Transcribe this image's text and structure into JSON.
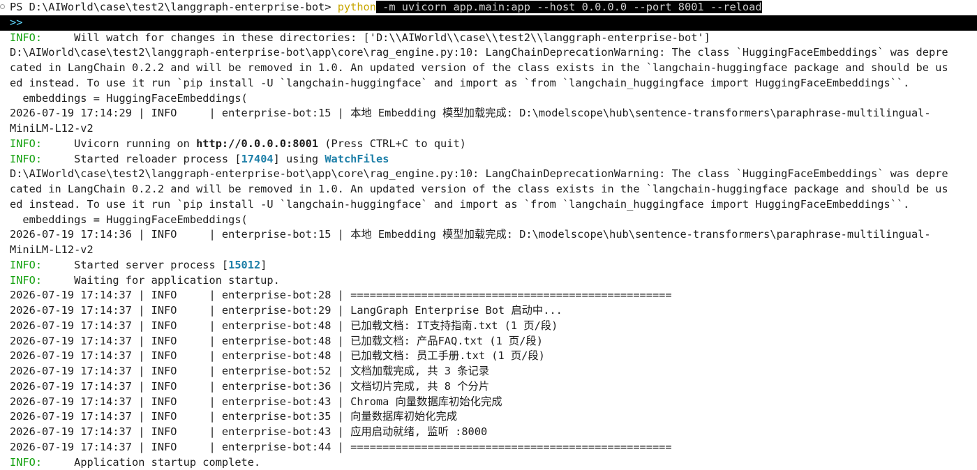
{
  "window": {
    "type": "PowerShell terminal"
  },
  "prompt": {
    "ps_prefix": "PS D:\\AIWorld\\case\\test2\\langgraph-enterprise-bot> ",
    "command": "python",
    "args": " -m uvicorn app.main:app --host 0.0.0.0 --port 8001 --reload",
    "continuation": ">>"
  },
  "output": {
    "l1_tag": "INFO:",
    "l1_text": "     Will watch for changes in these directories: ['D:\\\\AIWorld\\\\case\\\\test2\\\\langgraph-enterprise-bot']",
    "warn1_a": "D:\\AIWorld\\case\\test2\\langgraph-enterprise-bot\\app\\core\\rag_engine.py:10: LangChainDeprecationWarning: The class `HuggingFaceEmbeddings` was depre",
    "warn1_b": "cated in LangChain 0.2.2 and will be removed in 1.0. An updated version of the class exists in the `langchain-huggingface package and should be us",
    "warn1_c": "ed instead. To use it run `pip install -U `langchain-huggingface` and import as `from `langchain_huggingface import HuggingFaceEmbeddings``.",
    "warn1_d": "  embeddings = HuggingFaceEmbeddings(",
    "log1_a": "2026-07-19 17:14:29 | INFO     | enterprise-bot:15 | 本地 Embedding 模型加载完成: D:\\modelscope\\hub\\sentence-transformers\\paraphrase-multilingual-",
    "log1_b": "MiniLM-L12-v2",
    "l2_tag": "INFO:",
    "l2_pre": "     Uvicorn running on ",
    "l2_url": "http://0.0.0.0:8001",
    "l2_post": " (Press CTRL+C to quit)",
    "l3_tag": "INFO:",
    "l3_pre": "     Started reloader process [",
    "l3_pid": "17404",
    "l3_mid": "] using ",
    "l3_watch": "WatchFiles",
    "warn2_a": "D:\\AIWorld\\case\\test2\\langgraph-enterprise-bot\\app\\core\\rag_engine.py:10: LangChainDeprecationWarning: The class `HuggingFaceEmbeddings` was depre",
    "warn2_b": "cated in LangChain 0.2.2 and will be removed in 1.0. An updated version of the class exists in the `langchain-huggingface package and should be us",
    "warn2_c": "ed instead. To use it run `pip install -U `langchain-huggingface` and import as `from `langchain_huggingface import HuggingFaceEmbeddings``.",
    "warn2_d": "  embeddings = HuggingFaceEmbeddings(",
    "log2_a": "2026-07-19 17:14:36 | INFO     | enterprise-bot:15 | 本地 Embedding 模型加载完成: D:\\modelscope\\hub\\sentence-transformers\\paraphrase-multilingual-",
    "log2_b": "MiniLM-L12-v2",
    "l4_tag": "INFO:",
    "l4_pre": "     Started server process [",
    "l4_pid": "15012",
    "l4_post": "]",
    "l5_tag": "INFO:",
    "l5_text": "     Waiting for application startup.",
    "logs": [
      "2026-07-19 17:14:37 | INFO     | enterprise-bot:28 | ==================================================",
      "2026-07-19 17:14:37 | INFO     | enterprise-bot:29 | LangGraph Enterprise Bot 启动中...",
      "2026-07-19 17:14:37 | INFO     | enterprise-bot:48 | 已加载文档: IT支持指南.txt (1 页/段)",
      "2026-07-19 17:14:37 | INFO     | enterprise-bot:48 | 已加载文档: 产品FAQ.txt (1 页/段)",
      "2026-07-19 17:14:37 | INFO     | enterprise-bot:48 | 已加载文档: 员工手册.txt (1 页/段)",
      "2026-07-19 17:14:37 | INFO     | enterprise-bot:52 | 文档加载完成, 共 3 条记录",
      "2026-07-19 17:14:37 | INFO     | enterprise-bot:36 | 文档切片完成, 共 8 个分片",
      "2026-07-19 17:14:37 | INFO     | enterprise-bot:43 | Chroma 向量数据库初始化完成",
      "2026-07-19 17:14:37 | INFO     | enterprise-bot:35 | 向量数据库初始化完成",
      "2026-07-19 17:14:37 | INFO     | enterprise-bot:43 | 应用启动就绪, 监听 :8000",
      "2026-07-19 17:14:37 | INFO     | enterprise-bot:44 | =================================================="
    ],
    "l6_tag": "INFO:",
    "l6_text": "     Application startup complete."
  },
  "colors": {
    "info_tag": "#13a10e",
    "python_cmd": "#c8a600",
    "highlight": "#1d7fa8",
    "selection_bg": "#000000"
  }
}
